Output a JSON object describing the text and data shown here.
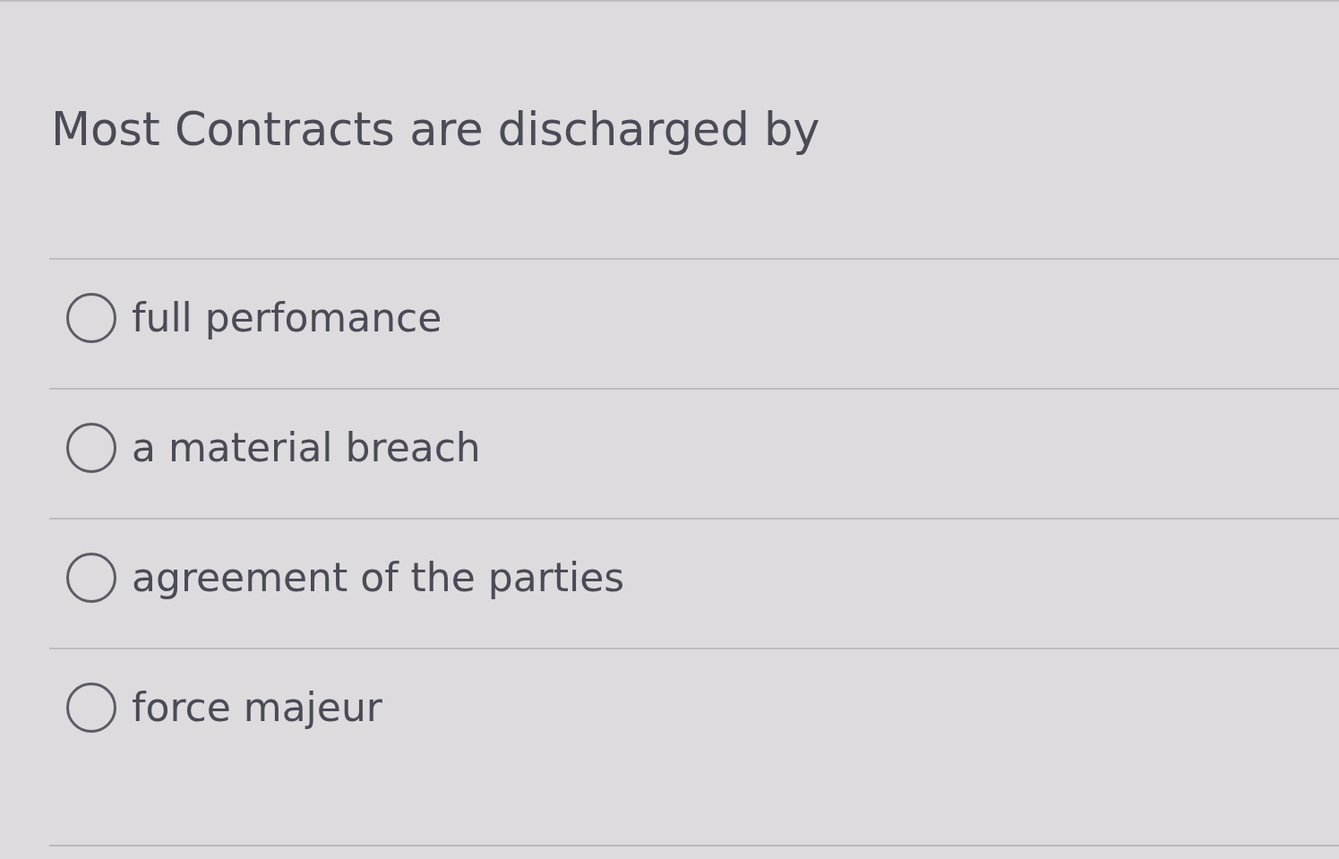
{
  "question": {
    "text": "Most Contracts are discharged by"
  },
  "options": [
    {
      "label": "full perfomance",
      "selected": false
    },
    {
      "label": "a material breach",
      "selected": false
    },
    {
      "label": "agreement of the parties",
      "selected": false
    },
    {
      "label": "force majeur",
      "selected": false
    }
  ]
}
